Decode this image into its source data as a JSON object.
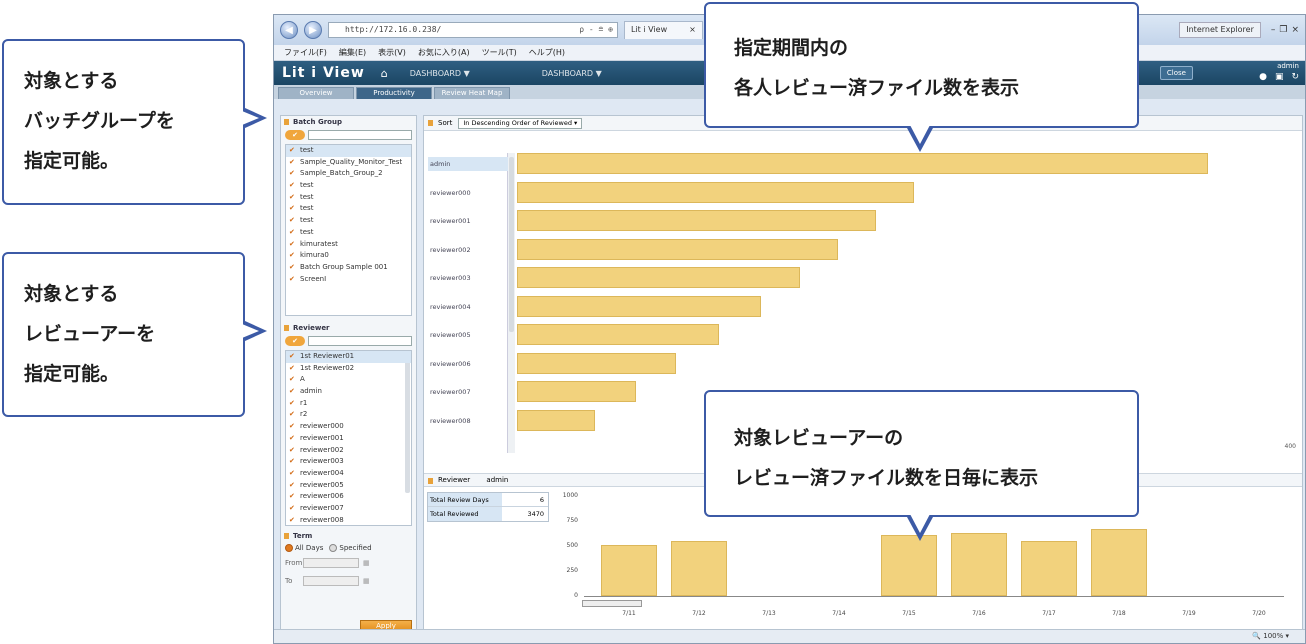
{
  "callouts": {
    "batch": {
      "lines": [
        "対象とする",
        "バッチグループを",
        "指定可能。"
      ]
    },
    "reviewer": {
      "lines": [
        "対象とする",
        "レビューアーを",
        "指定可能。"
      ]
    },
    "top": {
      "lines": [
        "指定期間内の",
        "各人レビュー済ファイル数を表示"
      ]
    },
    "bottom": {
      "lines": [
        "対象レビューアーの",
        "レビュー済ファイル数を日毎に表示"
      ]
    }
  },
  "browser": {
    "address": "http://172.16.0.238/",
    "address_tools": "ρ - ≘ ⊕",
    "tab_title": "Lit i View",
    "tab_close": "×",
    "other_tab": "Internet Explorer",
    "window_controls": [
      "–",
      "❐",
      "×"
    ],
    "menu": [
      "ファイル(F)",
      "編集(E)",
      "表示(V)",
      "お気に入り(A)",
      "ツール(T)",
      "ヘルプ(H)"
    ],
    "zoom": "100%"
  },
  "app": {
    "logo": "Lit i View",
    "dashboard_menu": "DASHBOARD ▼",
    "dashboard_menu_2": "DASHBOARD ▼",
    "close_label": "Close",
    "user": "admin",
    "tabs": [
      "Overview",
      "Productivity",
      "Review Heat Map"
    ],
    "active_tab": 1
  },
  "left": {
    "batch_title": "Batch Group",
    "batch_items": [
      "test",
      "Sample_Quality_Monitor_Test",
      "Sample_Batch_Group_2",
      "test",
      "test",
      "test",
      "test",
      "test",
      "kimuratest",
      "kimura0",
      "Batch Group Sample 001",
      "ScreenI"
    ],
    "batch_selected": 0,
    "reviewer_title": "Reviewer",
    "reviewer_items": [
      "1st Reviewer01",
      "1st Reviewer02",
      "A",
      "admin",
      "r1",
      "r2",
      "reviewer000",
      "reviewer001",
      "reviewer002",
      "reviewer003",
      "reviewer004",
      "reviewer005",
      "reviewer006",
      "reviewer007",
      "reviewer008"
    ],
    "reviewer_selected": 0,
    "term_title": "Term",
    "all_days": "All Days",
    "specified": "Specified",
    "from_label": "From",
    "to_label": "To",
    "apply": "Apply",
    "check_label": "✔"
  },
  "main": {
    "sort_label": "Sort",
    "sort_value": "In Descending Order of Reviewed ▾",
    "reviewer_bar_label": "Reviewer",
    "reviewer_name": "admin",
    "stats": [
      {
        "label": "Total Review Days",
        "value": "6"
      },
      {
        "label": "Total Reviewed",
        "value": "3470"
      }
    ]
  },
  "chart_data": [
    {
      "type": "bar",
      "orientation": "horizontal",
      "categories": [
        "admin",
        "reviewer000",
        "reviewer001",
        "reviewer002",
        "reviewer003",
        "reviewer004",
        "reviewer005",
        "reviewer006",
        "reviewer007",
        "reviewer008"
      ],
      "values": [
        400,
        230,
        208,
        186,
        164,
        141,
        117,
        92,
        69,
        45
      ],
      "xlim": [
        0,
        440
      ],
      "axis_max_label": "400",
      "highlighted": "admin"
    },
    {
      "type": "bar",
      "categories": [
        "7/11",
        "7/12",
        "7/13",
        "7/14",
        "7/15",
        "7/16",
        "7/17",
        "7/18",
        "7/19",
        "7/20"
      ],
      "values": [
        510,
        550,
        0,
        0,
        610,
        630,
        550,
        670,
        0,
        0
      ],
      "ylim": [
        0,
        1000
      ],
      "yticks": [
        0,
        250,
        500,
        750,
        1000
      ]
    }
  ]
}
